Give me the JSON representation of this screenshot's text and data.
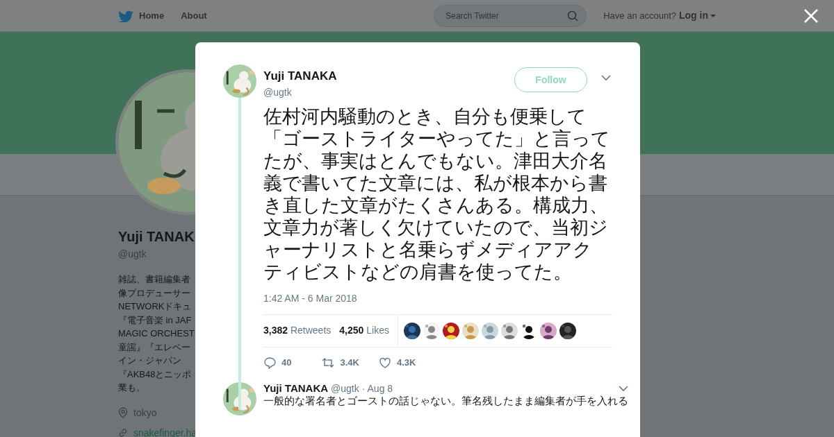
{
  "topnav": {
    "links": [
      {
        "label": "Home"
      },
      {
        "label": "About"
      }
    ],
    "search": {
      "placeholder": "Search Twitter"
    },
    "account_prompt": "Have an account?",
    "login": "Log in"
  },
  "profile": {
    "name": "Yuji TANAK",
    "handle": "@ugtk",
    "bio_lines": [
      "雑誌、書籍編集者",
      "像プロデューサー",
      "NETWORKドキュ",
      "『電子音楽 in JAF",
      "MAGIC ORCHEST",
      "童謡』『エレベー",
      "イン・ジャパン",
      "『AKB48とニッポ",
      "業も。"
    ],
    "location": "tokyo",
    "link": "snakefinger.ha"
  },
  "tweet": {
    "name": "Yuji TANAKA",
    "handle": "@ugtk",
    "follow": "Follow",
    "text": "佐村河内騒動のとき、自分も便乗して「ゴーストライターやってた」と言ってたが、事実はとんでもない。津田大介名義で書いてた文章には、私が根本から書き直した文章がたくさんある。構成力、文章力が著しく欠けていたので、当初ジャーナリストと名乗らずメディアアクティビストなどの肩書を使ってた。",
    "time": "1:42 AM - 6 Mar 2018",
    "stats": [
      {
        "count": "3,382",
        "label": "Retweets"
      },
      {
        "count": "4,250",
        "label": "Likes"
      }
    ],
    "actions": [
      {
        "kind": "reply",
        "count": "40"
      },
      {
        "kind": "retweet",
        "count": "3.4K"
      },
      {
        "kind": "like",
        "count": "4.3K"
      }
    ]
  },
  "reply": {
    "name": "Yuji TANAKA",
    "handle": "@ugtk",
    "date": "· Aug 8",
    "text": "一般的な署名者とゴーストの話じゃない。筆名残したまま編集者が手を入れる"
  }
}
